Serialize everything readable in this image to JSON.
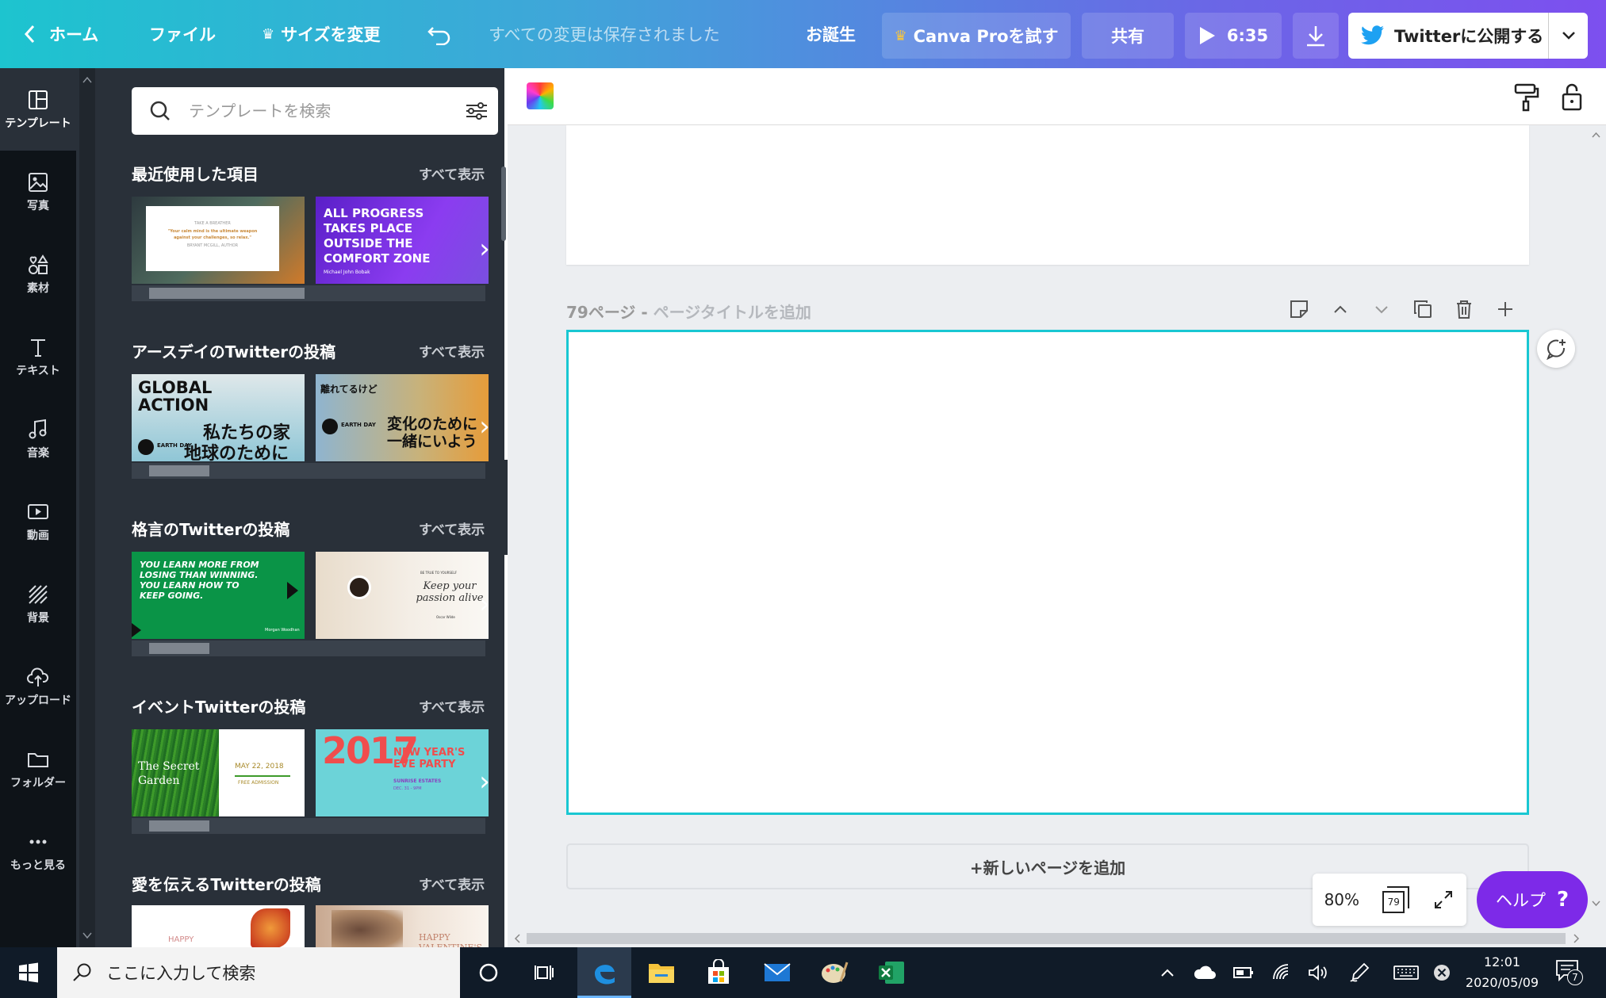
{
  "topbar": {
    "home": "ホーム",
    "file": "ファイル",
    "resize": "サイズを変更",
    "saved": "すべての変更は保存されました",
    "title": "お誕生",
    "try_pro": "Canva Proを試す",
    "share": "共有",
    "present_time": "6:35",
    "publish": "Twitterに公開する"
  },
  "leftnav": [
    {
      "label": "テンプレート",
      "icon": "template-icon"
    },
    {
      "label": "写真",
      "icon": "photo-icon"
    },
    {
      "label": "素材",
      "icon": "elements-icon"
    },
    {
      "label": "テキスト",
      "icon": "text-icon"
    },
    {
      "label": "音楽",
      "icon": "music-icon"
    },
    {
      "label": "動画",
      "icon": "video-icon"
    },
    {
      "label": "背景",
      "icon": "background-icon"
    },
    {
      "label": "アップロード",
      "icon": "upload-icon"
    },
    {
      "label": "フォルダー",
      "icon": "folder-icon"
    },
    {
      "label": "もっと見る",
      "icon": "more-icon"
    }
  ],
  "panel": {
    "search_placeholder": "テンプレートを検索",
    "see_all": "すべて表示",
    "sections": [
      {
        "title": "最近使用した項目",
        "thumbs": [
          {
            "lines": [
              "TAKE A BREATHER",
              "\"Your calm mind is the ultimate weapon against your challenges, so relax.\"",
              "BRYANT MCGILL, AUTHOR"
            ]
          },
          {
            "lines": [
              "ALL PROGRESS TAKES PLACE OUTSIDE THE COMFORT ZONE",
              "Michael John Bobak"
            ]
          }
        ]
      },
      {
        "title": "アースデイのTwitterの投稿",
        "thumbs": [
          {
            "lines": [
              "GLOBAL ACTION",
              "私たちの家",
              "地球のために",
              "EARTH DAY"
            ]
          },
          {
            "lines": [
              "離れてるけど",
              "変化のために",
              "一緒にいよう",
              "EARTH DAY"
            ]
          }
        ]
      },
      {
        "title": "格言のTwitterの投稿",
        "thumbs": [
          {
            "lines": [
              "YOU LEARN MORE FROM LOSING THAN WINNING. YOU LEARN HOW TO KEEP GOING.",
              "Morgan Woodhan"
            ]
          },
          {
            "lines": [
              "BE TRUE TO YOURSELF",
              "Keep your passion alive",
              "Oscar Wilde"
            ]
          }
        ]
      },
      {
        "title": "イベントTwitterの投稿",
        "thumbs": [
          {
            "lines": [
              "The Secret Garden",
              "MAY 22, 2018",
              "FREE ADMISSION"
            ]
          },
          {
            "lines": [
              "2017",
              "NEW YEAR'S EVE PARTY",
              "SUNRISE ESTATES",
              "DEC. 31 - 9PM"
            ]
          }
        ]
      },
      {
        "title": "愛を伝えるTwitterの投稿",
        "thumbs": [
          {
            "lines": [
              "HAPPY"
            ]
          },
          {
            "lines": [
              "HAPPY VALENTINE'S"
            ]
          }
        ]
      }
    ]
  },
  "canvas": {
    "page_label": "79ページ - ",
    "page_title_placeholder": "ページタイトルを追加",
    "add_page": "+新しいページを追加",
    "zoom": "80%",
    "page_count": "79",
    "help": "ヘルプ"
  },
  "taskbar": {
    "search_placeholder": "ここに入力して検索",
    "time": "12:01",
    "date": "2020/05/09",
    "notification_count": "7"
  },
  "colors": {
    "accent_cyan": "#19c7d2",
    "help_purple": "#7d2ae8",
    "panel_bg": "#293039",
    "nav_bg": "#0e1318"
  }
}
